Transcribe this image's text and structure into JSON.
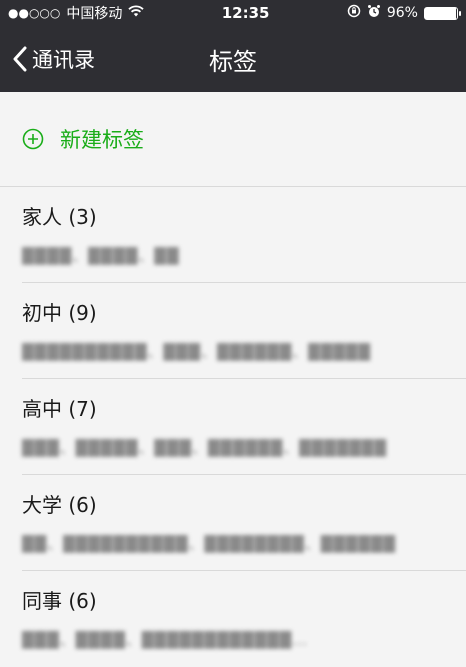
{
  "status_bar": {
    "signal": "●●○○○",
    "carrier": "中国移动",
    "time": "12:35",
    "battery": "96%",
    "battery_level": 0.96
  },
  "nav": {
    "back_label": "通讯录",
    "title": "标签"
  },
  "new_tag": {
    "label": "新建标签",
    "icon": "plus-circle-icon"
  },
  "groups": [
    {
      "title": "家人 (3)",
      "members": "████、████、██"
    },
    {
      "title": "初中 (9)",
      "members": "██████████、███、██████、█████"
    },
    {
      "title": "高中 (7)",
      "members": "███、█████、███、██████、███████"
    },
    {
      "title": "大学 (6)",
      "members": "██、██████████、████████、██████"
    },
    {
      "title": "同事 (6)",
      "members": "███、████、████████████…"
    }
  ],
  "colors": {
    "accent": "#1aad19",
    "nav_bg": "#2e2e33"
  }
}
